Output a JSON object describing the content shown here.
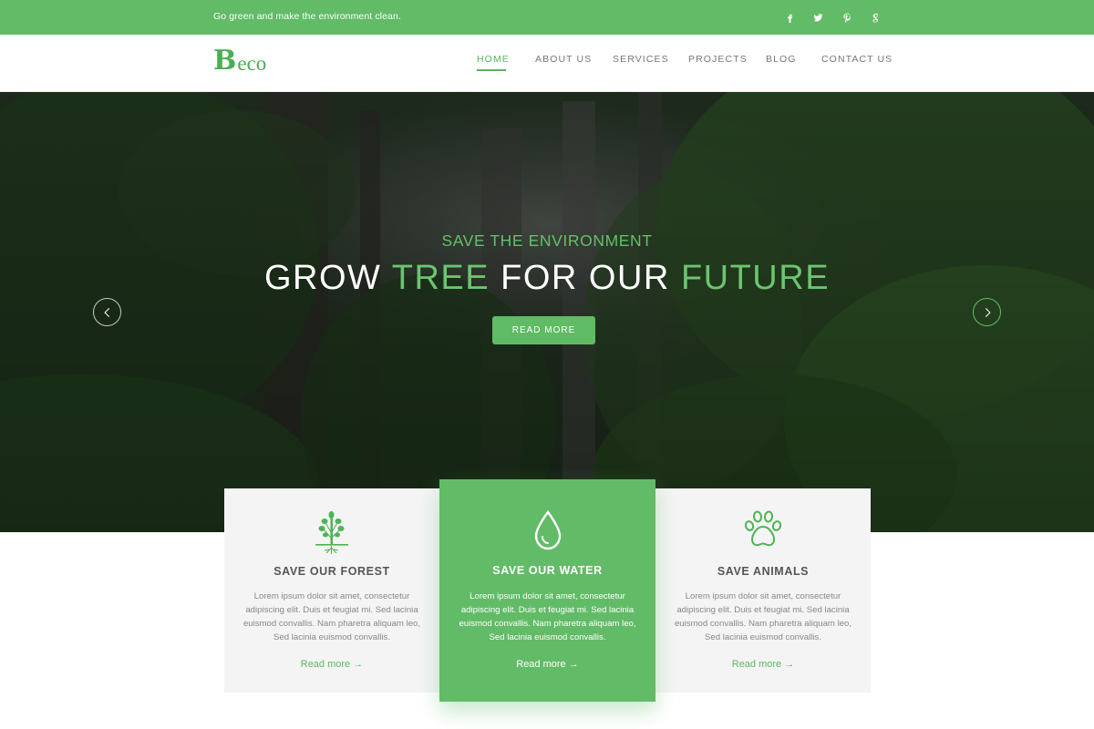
{
  "topbar": {
    "tagline": "Go green and make the environment clean.",
    "social": [
      "facebook-icon",
      "twitter-icon",
      "pinterest-icon",
      "google-plus-icon"
    ]
  },
  "header": {
    "logo_first": "B",
    "logo_rest": "eco",
    "nav": [
      {
        "label": "HOME",
        "active": true
      },
      {
        "label": "ABOUT US",
        "active": false
      },
      {
        "label": "SERVICES",
        "active": false
      },
      {
        "label": "PROJECTS",
        "active": false
      },
      {
        "label": "BLOG",
        "active": false
      },
      {
        "label": "CONTACT US",
        "active": false
      }
    ]
  },
  "hero": {
    "subtitle": "SAVE THE ENVIRONMENT",
    "title_part1": "GROW ",
    "title_part2": "TREE",
    "title_part3": " FOR OUR ",
    "title_part4": "FUTURE",
    "button": "READ MORE"
  },
  "cards": [
    {
      "icon": "tree-icon",
      "title": "SAVE OUR FOREST",
      "body": "Lorem ipsum dolor sit amet, consectetur adipiscing elit. Duis et feugiat mi. Sed lacinia euismod convallis. Nam pharetra aliquam leo, Sed lacinia euismod convallis.",
      "link": "Read more"
    },
    {
      "icon": "water-drop-icon",
      "title": "SAVE OUR WATER",
      "body": "Lorem ipsum dolor sit amet, consectetur adipiscing elit. Duis et feugiat mi. Sed lacinia euismod convallis. Nam pharetra aliquam leo, Sed lacinia euismod convallis.",
      "link": "Read more"
    },
    {
      "icon": "paw-icon",
      "title": "SAVE ANIMALS",
      "body": "Lorem ipsum dolor sit amet, consectetur adipiscing elit. Duis et feugiat mi. Sed lacinia euismod convallis. Nam pharetra aliquam leo, Sed lacinia euismod convallis.",
      "link": "Read more"
    }
  ],
  "colors": {
    "brand_green": "#62bb67",
    "text_grey": "#666666",
    "card_grey": "#f4f4f4"
  }
}
